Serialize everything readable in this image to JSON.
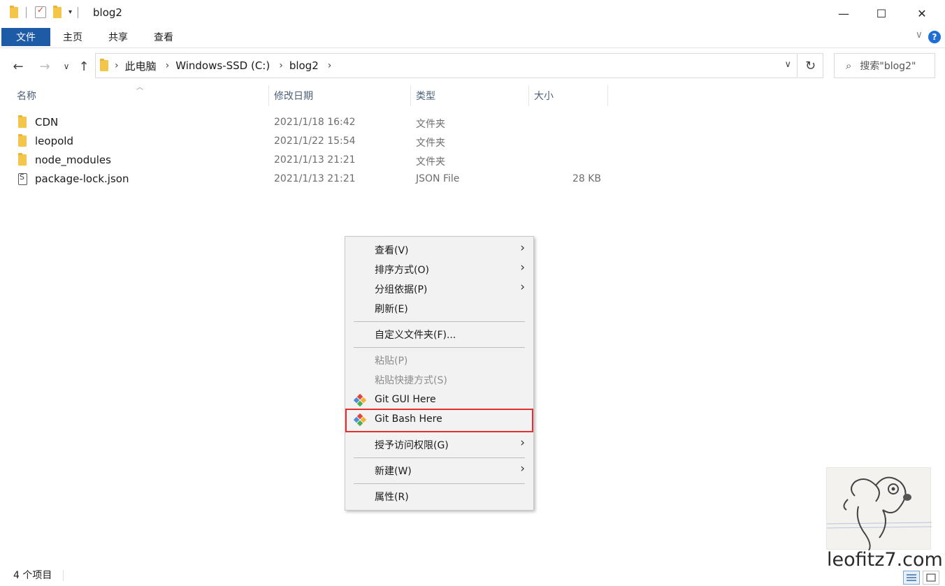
{
  "window": {
    "title": "blog2",
    "minimize": "—",
    "maximize": "☐",
    "close": "✕"
  },
  "ribbon": {
    "tabs": [
      "文件",
      "主页",
      "共享",
      "查看"
    ],
    "help": "?"
  },
  "nav": {
    "back": "←",
    "forward": "→",
    "recent": "∨",
    "up": "↑",
    "breadcrumbs": [
      "此电脑",
      "Windows-SSD (C:)",
      "blog2"
    ],
    "refresh": "↻",
    "search_placeholder": "搜索\"blog2\""
  },
  "columns": [
    "名称",
    "修改日期",
    "类型",
    "大小"
  ],
  "files": [
    {
      "name": "CDN",
      "date": "2021/1/18 16:42",
      "type": "文件夹",
      "size": "",
      "icon": "folder-icon"
    },
    {
      "name": "leopold",
      "date": "2021/1/22 15:54",
      "type": "文件夹",
      "size": "",
      "icon": "folder-icon"
    },
    {
      "name": "node_modules",
      "date": "2021/1/13 21:21",
      "type": "文件夹",
      "size": "",
      "icon": "folder-icon"
    },
    {
      "name": "package-lock.json",
      "date": "2021/1/13 21:21",
      "type": "JSON File",
      "size": "28 KB",
      "icon": "json-file-icon"
    }
  ],
  "context_menu": {
    "items": [
      {
        "label": "查看(V)",
        "submenu": true,
        "disabled": false
      },
      {
        "label": "排序方式(O)",
        "submenu": true,
        "disabled": false
      },
      {
        "label": "分组依据(P)",
        "submenu": true,
        "disabled": false
      },
      {
        "label": "刷新(E)",
        "submenu": false,
        "disabled": false
      },
      {
        "label": "自定义文件夹(F)...",
        "submenu": false,
        "disabled": false
      },
      {
        "label": "粘贴(P)",
        "submenu": false,
        "disabled": true
      },
      {
        "label": "粘贴快捷方式(S)",
        "submenu": false,
        "disabled": true
      },
      {
        "label": "Git GUI Here",
        "submenu": false,
        "disabled": false,
        "icon": "git-icon"
      },
      {
        "label": "Git Bash Here",
        "submenu": false,
        "disabled": false,
        "icon": "git-icon",
        "highlighted": true
      },
      {
        "label": "授予访问权限(G)",
        "submenu": true,
        "disabled": false
      },
      {
        "label": "新建(W)",
        "submenu": true,
        "disabled": false
      },
      {
        "label": "属性(R)",
        "submenu": false,
        "disabled": false
      }
    ],
    "highlight_color": "#e03030"
  },
  "watermark": {
    "text": "leofitz7.com"
  },
  "status": {
    "item_count": "4 个项目"
  },
  "colors": {
    "file_tab": "#1d5ba6",
    "folder": "#f3c64a",
    "accent": "#1e6fd1"
  }
}
